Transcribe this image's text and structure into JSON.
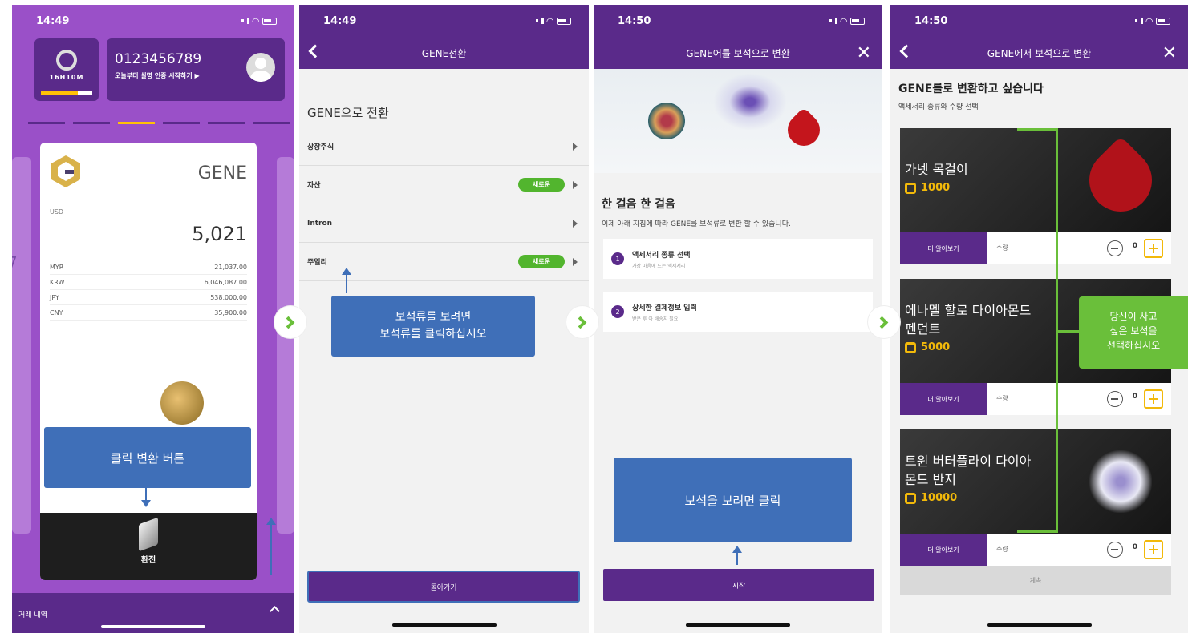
{
  "screen1": {
    "time": "14:49",
    "logo_text": "16H10M",
    "account_number": "0123456789",
    "verify_text": "오늘부터 실명 인증 시작하기 ▶",
    "card_title": "GENE",
    "usd_label": "USD",
    "usd_value": "5,021",
    "rates": [
      {
        "code": "MYR",
        "value": "21,037.00"
      },
      {
        "code": "KRW",
        "value": "6,046,087.00"
      },
      {
        "code": "JPY",
        "value": "538,000.00"
      },
      {
        "code": "CNY",
        "value": "35,900.00"
      }
    ],
    "convert_label": "환전",
    "transactions_label": "거래 내역",
    "side_left_text": "7",
    "callout": "클릭 변환 버튼"
  },
  "screen2": {
    "time": "14:49",
    "title": "GENE전환",
    "heading": "GENE으로 전환",
    "items": [
      {
        "label": "상장주식",
        "badge": ""
      },
      {
        "label": "자산",
        "badge": "새로운"
      },
      {
        "label": "Intron",
        "badge": ""
      },
      {
        "label": "주얼리",
        "badge": "새로운"
      }
    ],
    "back_button": "돌아가기",
    "callout_line1": "보석류를 보려면",
    "callout_line2": "보석류를 클릭하십시오"
  },
  "screen3": {
    "time": "14:50",
    "title": "GENE어를 보석으로 변환",
    "heading": "한 걸음 한 걸음",
    "subheading": "이제 아래 지침에 따라 GENE를 보석류로 변환 할 수 있습니다.",
    "steps": [
      {
        "num": "1",
        "title": "액세서리 종류 선택",
        "desc": "가장 마음에 드는 액세서리"
      },
      {
        "num": "2",
        "title": "상세한 결제정보 입력",
        "desc": "받은 후 아 배송지 필요"
      }
    ],
    "start_button": "시작",
    "callout": "보석을 보려면 클릭"
  },
  "screen4": {
    "time": "14:50",
    "title": "GENE에서 보석으로 변환",
    "heading": "GENE를로 변환하고 싶습니다",
    "subheading": "액세서리 종류와 수량 선택",
    "products": [
      {
        "name": "가넷 목걸이",
        "price": "1000",
        "more": "더 알아보기",
        "qty_label": "수량",
        "qty": "0"
      },
      {
        "name": "에나멜 할로 다이아몬드 펜던트",
        "price": "5000",
        "more": "더 알아보기",
        "qty_label": "수량",
        "qty": "0"
      },
      {
        "name": "트윈 버터플라이 다이아몬드 반지",
        "price": "10000",
        "more": "더 알아보기",
        "qty_label": "수량",
        "qty": "0"
      }
    ],
    "continue_button": "계속",
    "callout_line1": "당신이 사고",
    "callout_line2": "싶은 보석을",
    "callout_line3": "선택하십시오"
  }
}
